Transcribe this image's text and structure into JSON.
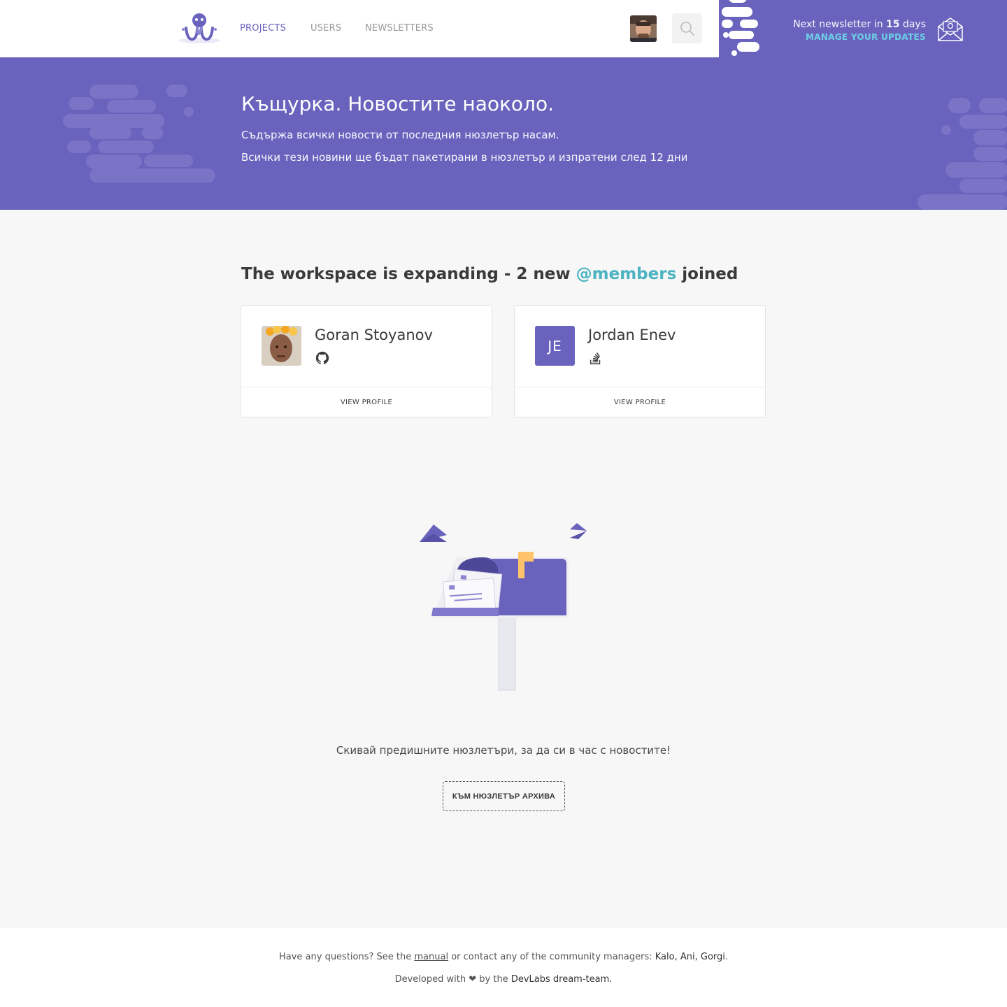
{
  "nav": {
    "items": [
      {
        "label": "PROJECTS",
        "active": true
      },
      {
        "label": "USERS",
        "active": false
      },
      {
        "label": "NEWSLETTERS",
        "active": false
      }
    ]
  },
  "newsletter": {
    "prefix": "Next newsletter in",
    "days": "15",
    "suffix": "days",
    "manage_label": "MANAGE YOUR UPDATES"
  },
  "hero": {
    "title": "Къщурка. Новостите наоколо.",
    "line1": "Съдържа всички новости от последния нюзлетър насам.",
    "line2": "Всички тези новини ще бъдат пакетирани в нюзлетър и изпратени след 12 дни"
  },
  "members_section": {
    "title_prefix": "The workspace is expanding - 2 new",
    "mention": "@members",
    "title_suffix": "joined",
    "members": [
      {
        "name": "Goran Stoyanov",
        "social_icon": "github-icon",
        "view_label": "VIEW PROFILE"
      },
      {
        "name": "Jordan Enev",
        "initials": "JE",
        "social_icon": "stackoverflow-icon",
        "view_label": "VIEW PROFILE"
      }
    ]
  },
  "archive": {
    "text": "Скивай предишните нюзлетъри, за да си в час с новостите!",
    "button_label": "КЪМ НЮЗЛЕТЪР АРХИВА"
  },
  "footer": {
    "q_prefix": "Have any questions? See the",
    "manual_link": "manual",
    "q_middle": "or contact any of the community managers:",
    "managers": "Kalo, Ani, Gorgi",
    "q_end": ".",
    "dev_prefix": "Developed with",
    "heart": "❤",
    "dev_middle": "by the",
    "team": "DevLabs dream-team."
  },
  "colors": {
    "brand_purple": "#6a63be",
    "accent_cyan": "#6dd0e5",
    "mention_teal": "#4bb3c2",
    "flag_orange": "#ffc46b"
  }
}
